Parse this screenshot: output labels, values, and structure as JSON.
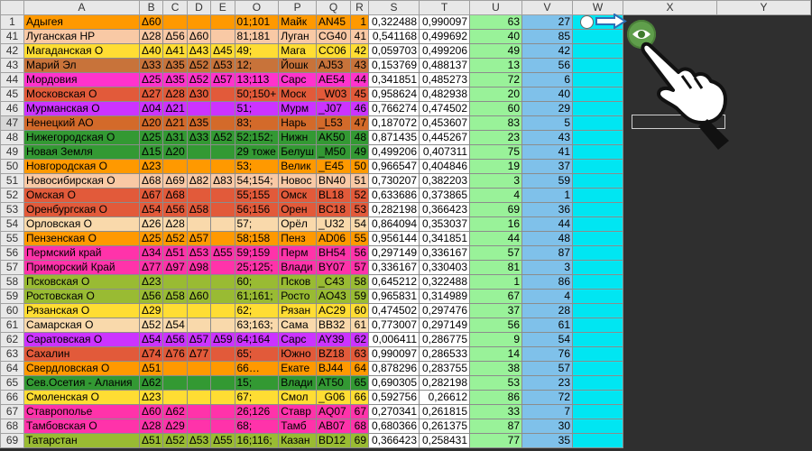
{
  "columns": [
    "",
    "A",
    "B",
    "C",
    "D",
    "E",
    "O",
    "P",
    "Q",
    "R",
    "S",
    "T",
    "U",
    "V",
    "W",
    "X",
    "Y"
  ],
  "rows": [
    {
      "n": "1",
      "a": "Адыгея",
      "b": "Δ60",
      "c": "",
      "d": "",
      "e": "",
      "o": "01;101",
      "p": "Майк",
      "q": "AN45",
      "r": "1",
      "s": "0,322488",
      "t": "0,990097",
      "u": "63",
      "v": "27",
      "color": "#ff9900"
    },
    {
      "n": "41",
      "a": "Луганская НР",
      "b": "Δ28",
      "c": "Δ56",
      "d": "Δ60",
      "e": "",
      "o": "81;181",
      "p": "Луган",
      "q": "CG40",
      "r": "41",
      "s": "0,541168",
      "t": "0,499692",
      "u": "40",
      "v": "85",
      "color": "#f9c9a5"
    },
    {
      "n": "42",
      "a": "Магаданская О",
      "b": "Δ40",
      "c": "Δ41",
      "d": "Δ43",
      "e": "Δ45",
      "o": "49;",
      "p": "Мага",
      "q": "CC06",
      "r": "42",
      "s": "0,059703",
      "t": "0,499206",
      "u": "49",
      "v": "42",
      "color": "#ffdd33"
    },
    {
      "n": "43",
      "a": "Марий Эл",
      "b": "Δ33",
      "c": "Δ35",
      "d": "Δ52",
      "e": "Δ53",
      "o": "12;",
      "p": "Йошк",
      "q": "AJ53",
      "r": "43",
      "s": "0,153769",
      "t": "0,488137",
      "u": "13",
      "v": "56",
      "color": "#c8733a"
    },
    {
      "n": "44",
      "a": "Мордовия",
      "b": "Δ25",
      "c": "Δ35",
      "d": "Δ52",
      "e": "Δ57",
      "o": "13;113",
      "p": "Сарс",
      "q": "AE54",
      "r": "44",
      "s": "0,341851",
      "t": "0,485273",
      "u": "72",
      "v": "6",
      "color": "#ff33cc"
    },
    {
      "n": "45",
      "a": "Московская О",
      "b": "Δ27",
      "c": "Δ28",
      "d": "Δ30",
      "e": "",
      "o": "50;150+",
      "p": "Моск",
      "q": "_W03",
      "r": "45",
      "s": "0,958624",
      "t": "0,482938",
      "u": "20",
      "v": "40",
      "color": "#e25a3a"
    },
    {
      "n": "46",
      "a": "Мурманская О",
      "b": "Δ04",
      "c": "Δ21",
      "d": "",
      "e": "",
      "o": "51;",
      "p": "Мурм",
      "q": "_J07",
      "r": "46",
      "s": "0,766274",
      "t": "0,474502",
      "u": "60",
      "v": "29",
      "color": "#cc33ff"
    },
    {
      "n": "47",
      "a": "Ненецкий АО",
      "b": "Δ20",
      "c": "Δ21",
      "d": "Δ35",
      "e": "",
      "o": "83;",
      "p": "Нарь",
      "q": "_L53",
      "r": "47",
      "s": "0,187072",
      "t": "0,453607",
      "u": "83",
      "v": "5",
      "color": "#d36a2a"
    },
    {
      "n": "48",
      "a": "Нижегородская О",
      "b": "Δ25",
      "c": "Δ31",
      "d": "Δ33",
      "e": "Δ52",
      "o": "52;152;",
      "p": "Нижн",
      "q": "AK50",
      "r": "48",
      "s": "0,871435",
      "t": "0,445267",
      "u": "23",
      "v": "43",
      "color": "#339933"
    },
    {
      "n": "49",
      "a": "Новая Земля",
      "b": "Δ15",
      "c": "Δ20",
      "d": "",
      "e": "",
      "o": "29 тоже",
      "p": "Белуш",
      "q": "_M50",
      "r": "49",
      "s": "0,499206",
      "t": "0,407311",
      "u": "75",
      "v": "41",
      "color": "#339933"
    },
    {
      "n": "50",
      "a": "Новгородская О",
      "b": "Δ23",
      "c": "",
      "d": "",
      "e": "",
      "o": "53;",
      "p": "Велик",
      "q": "_E45",
      "r": "50",
      "s": "0,966547",
      "t": "0,404846",
      "u": "19",
      "v": "37",
      "color": "#ff9900"
    },
    {
      "n": "51",
      "a": "Новосибирская О",
      "b": "Δ68",
      "c": "Δ69",
      "d": "Δ82",
      "e": "Δ83",
      "o": "54;154;",
      "p": "Новос",
      "q": "BN40",
      "r": "51",
      "s": "0,730207",
      "t": "0,382203",
      "u": "3",
      "v": "59",
      "color": "#f9c9a5"
    },
    {
      "n": "52",
      "a": "Омская О",
      "b": "Δ67",
      "c": "Δ68",
      "d": "",
      "e": "",
      "o": "55;155",
      "p": "Омск",
      "q": "BL18",
      "r": "52",
      "s": "0,633686",
      "t": "0,373865",
      "u": "4",
      "v": "1",
      "color": "#e25a3a"
    },
    {
      "n": "53",
      "a": "Оренбургская О",
      "b": "Δ54",
      "c": "Δ56",
      "d": "Δ58",
      "e": "",
      "o": "56;156",
      "p": "Орен",
      "q": "BC18",
      "r": "53",
      "s": "0,282198",
      "t": "0,366423",
      "u": "69",
      "v": "36",
      "color": "#e25a3a"
    },
    {
      "n": "54",
      "a": "Орловская О",
      "b": "Δ26",
      "c": "Δ28",
      "d": "",
      "e": "",
      "o": "57;",
      "p": "Орёл",
      "q": "_U32",
      "r": "54",
      "s": "0,864094",
      "t": "0,353037",
      "u": "16",
      "v": "44",
      "color": "#f9d9ab"
    },
    {
      "n": "55",
      "a": "Пензенская О",
      "b": "Δ25",
      "c": "Δ52",
      "d": "Δ57",
      "e": "",
      "o": "58;158",
      "p": "Пенз",
      "q": "AD06",
      "r": "55",
      "s": "0,956144",
      "t": "0,341851",
      "u": "44",
      "v": "48",
      "color": "#ff9900"
    },
    {
      "n": "56",
      "a": "Пермский край",
      "b": "Δ34",
      "c": "Δ51",
      "d": "Δ53",
      "e": "Δ55",
      "o": "59;159",
      "p": "Перм",
      "q": "BH54",
      "r": "56",
      "s": "0,297149",
      "t": "0,336167",
      "u": "57",
      "v": "87",
      "color": "#ff33aa"
    },
    {
      "n": "57",
      "a": "Приморский Край",
      "b": "Δ77",
      "c": "Δ97",
      "d": "Δ98",
      "e": "",
      "o": "25;125;",
      "p": "Влади",
      "q": "BY07",
      "r": "57",
      "s": "0,336167",
      "t": "0,330403",
      "u": "81",
      "v": "3",
      "color": "#ff33aa"
    },
    {
      "n": "58",
      "a": "Псковская О",
      "b": "Δ23",
      "c": "",
      "d": "",
      "e": "",
      "o": "60;",
      "p": "Псков",
      "q": "_C43",
      "r": "58",
      "s": "0,645212",
      "t": "0,322488",
      "u": "1",
      "v": "86",
      "color": "#99bb33"
    },
    {
      "n": "59",
      "a": "Ростовская О",
      "b": "Δ56",
      "c": "Δ58",
      "d": "Δ60",
      "e": "",
      "o": "61;161;",
      "p": "Росто",
      "q": "AO43",
      "r": "59",
      "s": "0,965831",
      "t": "0,314989",
      "u": "67",
      "v": "4",
      "color": "#99bb33"
    },
    {
      "n": "60",
      "a": "Рязанская О",
      "b": "Δ29",
      "c": "",
      "d": "",
      "e": "",
      "o": "62;",
      "p": "Рязан",
      "q": "AC29",
      "r": "60",
      "s": "0,474502",
      "t": "0,297476",
      "u": "37",
      "v": "28",
      "color": "#ffdd33"
    },
    {
      "n": "61",
      "a": "Самарская О",
      "b": "Δ52",
      "c": "Δ54",
      "d": "",
      "e": "",
      "o": "63;163;",
      "p": "Сама",
      "q": "BB32",
      "r": "61",
      "s": "0,773007",
      "t": "0,297149",
      "u": "56",
      "v": "61",
      "color": "#f9d9ab"
    },
    {
      "n": "62",
      "a": "Саратовская О",
      "b": "Δ54",
      "c": "Δ56",
      "d": "Δ57",
      "e": "Δ59",
      "o": "64;164",
      "p": "Сарс",
      "q": "AY39",
      "r": "62",
      "s": "0,006411",
      "t": "0,286775",
      "u": "9",
      "v": "54",
      "color": "#cc33ff"
    },
    {
      "n": "63",
      "a": "Сахалин",
      "b": "Δ74",
      "c": "Δ76",
      "d": "Δ77",
      "e": "",
      "o": "65;",
      "p": "Южно",
      "q": "BZ18",
      "r": "63",
      "s": "0,990097",
      "t": "0,286533",
      "u": "14",
      "v": "76",
      "color": "#e25a3a"
    },
    {
      "n": "64",
      "a": "Свердловская О",
      "b": "Δ51",
      "c": "",
      "d": "",
      "e": "",
      "o": "66…",
      "p": "Екате",
      "q": "BJ44",
      "r": "64",
      "s": "0,878296",
      "t": "0,283755",
      "u": "38",
      "v": "57",
      "color": "#ff9900"
    },
    {
      "n": "65",
      "a": "Сев.Осетия - Алания",
      "b": "Δ62",
      "c": "",
      "d": "",
      "e": "",
      "o": "15;",
      "p": "Влади",
      "q": "AT50",
      "r": "65",
      "s": "0,690305",
      "t": "0,282198",
      "u": "53",
      "v": "23",
      "color": "#339933"
    },
    {
      "n": "66",
      "a": "Смоленская О",
      "b": "Δ23",
      "c": "",
      "d": "",
      "e": "",
      "o": "67;",
      "p": "Смол",
      "q": "_G06",
      "r": "66",
      "s": "0,592756",
      "t": "0,26612",
      "u": "86",
      "v": "72",
      "color": "#ffdd33"
    },
    {
      "n": "67",
      "a": "Ставрополье",
      "b": "Δ60",
      "c": "Δ62",
      "d": "",
      "e": "",
      "o": "26;126",
      "p": "Ставр",
      "q": "AQ07",
      "r": "67",
      "s": "0,270341",
      "t": "0,261815",
      "u": "33",
      "v": "7",
      "color": "#ff33aa"
    },
    {
      "n": "68",
      "a": "Тамбовская О",
      "b": "Δ28",
      "c": "Δ29",
      "d": "",
      "e": "",
      "o": "68;",
      "p": "Тамб",
      "q": "AB07",
      "r": "68",
      "s": "0,680366",
      "t": "0,261375",
      "u": "87",
      "v": "30",
      "color": "#ff33aa"
    },
    {
      "n": "69",
      "a": "Татарстан",
      "b": "Δ51",
      "c": "Δ52",
      "d": "Δ53",
      "e": "Δ55",
      "o": "16;116;",
      "p": "Казан",
      "q": "BD12",
      "r": "69",
      "s": "0,366423",
      "t": "0,258431",
      "u": "77",
      "v": "35",
      "color": "#99bb33"
    }
  ],
  "icons": {
    "eye": "eye-icon",
    "hand": "hand-pointer-icon",
    "arrow": "arrow-right-icon",
    "oval": "circle-button-icon"
  }
}
